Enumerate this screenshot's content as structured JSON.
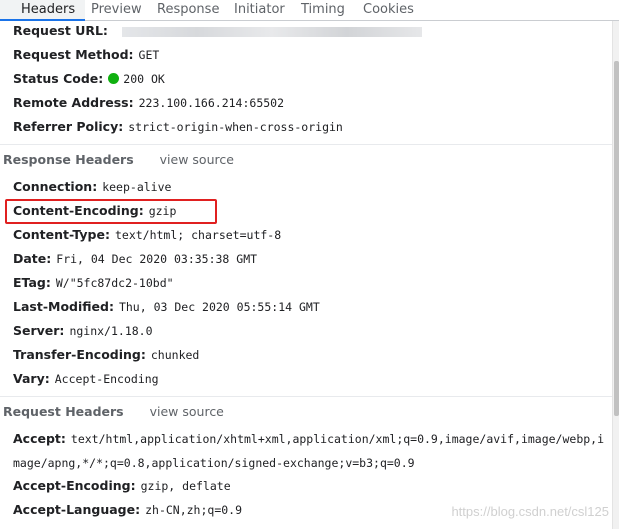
{
  "tabs": [
    {
      "label": "Headers",
      "active": true
    },
    {
      "label": "Preview"
    },
    {
      "label": "Response"
    },
    {
      "label": "Initiator"
    },
    {
      "label": "Timing"
    },
    {
      "label": "Cookies"
    }
  ],
  "general": {
    "request_url": {
      "key": "Request URL:",
      "value": ""
    },
    "request_method": {
      "key": "Request Method:",
      "value": "GET"
    },
    "status_code": {
      "key": "Status Code:",
      "value": "200 OK",
      "status_color": "#10b010"
    },
    "remote_address": {
      "key": "Remote Address:",
      "value": "223.100.166.214:65502"
    },
    "referrer_policy": {
      "key": "Referrer Policy:",
      "value": "strict-origin-when-cross-origin"
    }
  },
  "response_headers": {
    "title": "Response Headers",
    "view_source": "view source",
    "items": [
      {
        "key": "Connection:",
        "value": "keep-alive"
      },
      {
        "key": "Content-Encoding:",
        "value": "gzip",
        "highlighted": true
      },
      {
        "key": "Content-Type:",
        "value": "text/html; charset=utf-8"
      },
      {
        "key": "Date:",
        "value": "Fri, 04 Dec 2020 03:35:38 GMT"
      },
      {
        "key": "ETag:",
        "value": "W/\"5fc87dc2-10bd\""
      },
      {
        "key": "Last-Modified:",
        "value": "Thu, 03 Dec 2020 05:55:14 GMT"
      },
      {
        "key": "Server:",
        "value": "nginx/1.18.0"
      },
      {
        "key": "Transfer-Encoding:",
        "value": "chunked"
      },
      {
        "key": "Vary:",
        "value": "Accept-Encoding"
      }
    ]
  },
  "request_headers": {
    "title": "Request Headers",
    "view_source": "view source",
    "items": [
      {
        "key": "Accept:",
        "value": "text/html,application/xhtml+xml,application/xml;q=0.9,image/avif,image/webp,image/apng,*/*;q=0.8,application/signed-exchange;v=b3;q=0.9"
      },
      {
        "key": "Accept-Encoding:",
        "value": "gzip, deflate"
      },
      {
        "key": "Accept-Language:",
        "value": "zh-CN,zh;q=0.9"
      }
    ]
  },
  "highlight_color": "#e02020",
  "accent_color": "#1a73e8",
  "watermark": "https://blog.csdn.net/csl125"
}
